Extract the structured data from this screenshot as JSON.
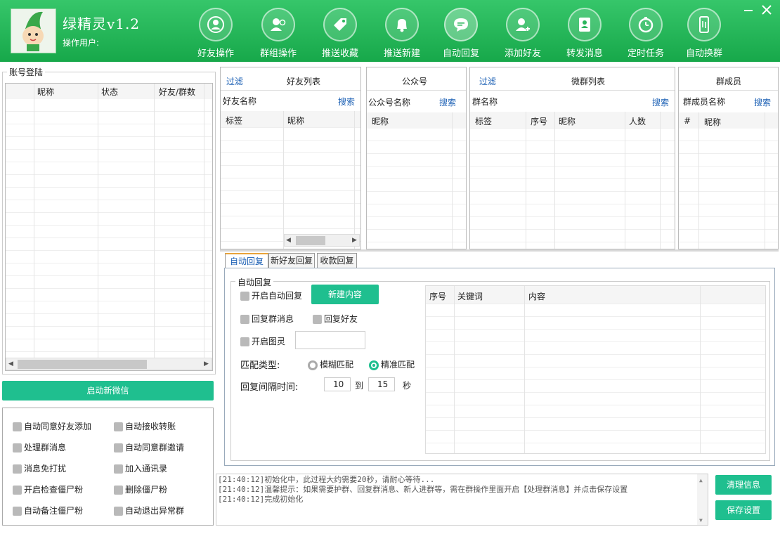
{
  "app": {
    "title": "绿精灵v1.2",
    "operator_label": "操作用户:"
  },
  "nav": [
    {
      "label": "好友操作",
      "icon": "user-circle-icon"
    },
    {
      "label": "群组操作",
      "icon": "users-icon"
    },
    {
      "label": "推送收藏",
      "icon": "tag-icon"
    },
    {
      "label": "推送新建",
      "icon": "bell-icon"
    },
    {
      "label": "自动回复",
      "icon": "chat-bubble-icon"
    },
    {
      "label": "添加好友",
      "icon": "add-user-icon"
    },
    {
      "label": "转发消息",
      "icon": "contact-card-icon"
    },
    {
      "label": "定时任务",
      "icon": "stopwatch-icon"
    },
    {
      "label": "自动换群",
      "icon": "phone-switch-icon"
    }
  ],
  "accounts": {
    "title": "账号登陆",
    "columns": [
      "昵称",
      "状态",
      "好友/群数"
    ],
    "start_button": "启动新微信"
  },
  "options": [
    {
      "label": "自动同意好友添加"
    },
    {
      "label": "自动接收转账"
    },
    {
      "label": "处理群消息"
    },
    {
      "label": "自动同意群邀请"
    },
    {
      "label": "消息免打扰"
    },
    {
      "label": "加入通讯录"
    },
    {
      "label": "开启检查僵尸粉"
    },
    {
      "label": "删除僵尸粉"
    },
    {
      "label": "自动备注僵尸粉"
    },
    {
      "label": "自动退出异常群"
    }
  ],
  "friends": {
    "filter": "过滤",
    "title": "好友列表",
    "search_label": "好友名称",
    "search": "搜索",
    "columns": [
      "标签",
      "昵称"
    ]
  },
  "official": {
    "title": "公众号",
    "search_label": "公众号名称",
    "search": "搜索",
    "columns": [
      "昵称"
    ]
  },
  "groups": {
    "filter": "过滤",
    "title": "微群列表",
    "search_label": "群名称",
    "search": "搜索",
    "columns": [
      "标签",
      "序号",
      "昵称",
      "人数"
    ]
  },
  "members": {
    "title": "群成员",
    "search_label": "群成员名称",
    "search": "搜索",
    "columns": [
      "#",
      "昵称"
    ]
  },
  "tabs": [
    "自动回复",
    "新好友回复",
    "收款回复"
  ],
  "autoreply": {
    "group_title": "自动回复",
    "enable": "开启自动回复",
    "new_content": "新建内容",
    "reply_group": "回复群消息",
    "reply_friend": "回复好友",
    "enable_tuling": "开启图灵",
    "match_type_label": "匹配类型:",
    "fuzzy": "模糊匹配",
    "exact": "精准匹配",
    "interval_label": "回复间隔时间:",
    "interval_from": "10",
    "to": "到",
    "interval_to": "15",
    "unit": "秒",
    "columns": [
      "序号",
      "关键词",
      "内容"
    ]
  },
  "log": [
    "[21:40:12]初始化中，此过程大约需要20秒，请耐心等待...",
    "[21:40:12]温馨提示：如果需要护群、回复群消息、新人进群等，需在群操作里面开启【处理群消息】并点击保存设置",
    "[21:40:12]完成初始化"
  ],
  "buttons": {
    "clear": "清理信息",
    "save": "保存设置"
  },
  "colors": {
    "header_green": "#1fae4f",
    "accent_teal": "#1fbf8f",
    "link_blue": "#1a5fb4"
  }
}
